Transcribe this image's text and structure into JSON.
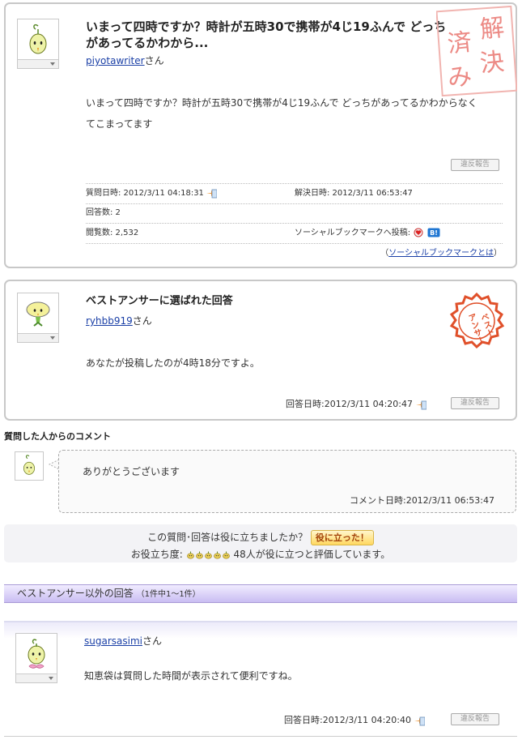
{
  "question": {
    "title": "いまって四時ですか？時計が五時30で携帯が4じ19ふんで どっちがあってるかわから...",
    "user": "piyotawriter",
    "user_suffix": "さん",
    "body_line1": "いまって四時ですか？時計が五時30で携帯が4じ19ふんで どっちがあってるかわからなく",
    "body_line2": "てこまってます",
    "report_label": "違反報告",
    "asked_label": "質問日時: 2012/3/11 04:18:31",
    "resolved_label": "解決日時: 2012/3/11 06:53:47",
    "answers_label": "回答数: 2",
    "views_label": "閲覧数: 2,532",
    "social_label": "ソーシャルブックマークへ投稿:",
    "social_link_open": "（",
    "social_link": "ソーシャルブックマークとは",
    "social_link_close": "）",
    "stamp_text": "解決済み",
    "stamp_color": "#e8736e"
  },
  "best_answer": {
    "heading": "ベストアンサーに選ばれた回答",
    "user": "ryhbb919",
    "user_suffix": "さん",
    "body": "あなたが投稿したのが4時18分ですよ。",
    "answered_label": "回答日時:2012/3/11 04:20:47",
    "report_label": "違反報告",
    "stamp_text": "ベストアンサー",
    "stamp_color": "#e0502a"
  },
  "asker_comment": {
    "section_title": "質問した人からのコメント",
    "text": "ありがとうございます",
    "time_label": "コメント日時:2012/3/11 06:53:47"
  },
  "helpful": {
    "question": "この質問･回答は役に立ちましたか？",
    "button": "役に立った！",
    "rating_label": "お役立ち度:",
    "rating_value": 5,
    "rating_max": 5,
    "summary": "48人が役に立つと評価しています。"
  },
  "other_answers": {
    "header": "ベストアンサー以外の回答",
    "count": "（1件中1～1件）",
    "items": [
      {
        "user": "sugarsasimi",
        "user_suffix": "さん",
        "body": "知恵袋は質問した時間が表示されて便利ですね。",
        "answered_label": "回答日時:2012/3/11 04:20:40",
        "report_label": "違反報告"
      }
    ]
  },
  "colors": {
    "link": "#1a3fa6",
    "header_band": "#c9bdf2",
    "helpful_button": "#ffd860"
  }
}
